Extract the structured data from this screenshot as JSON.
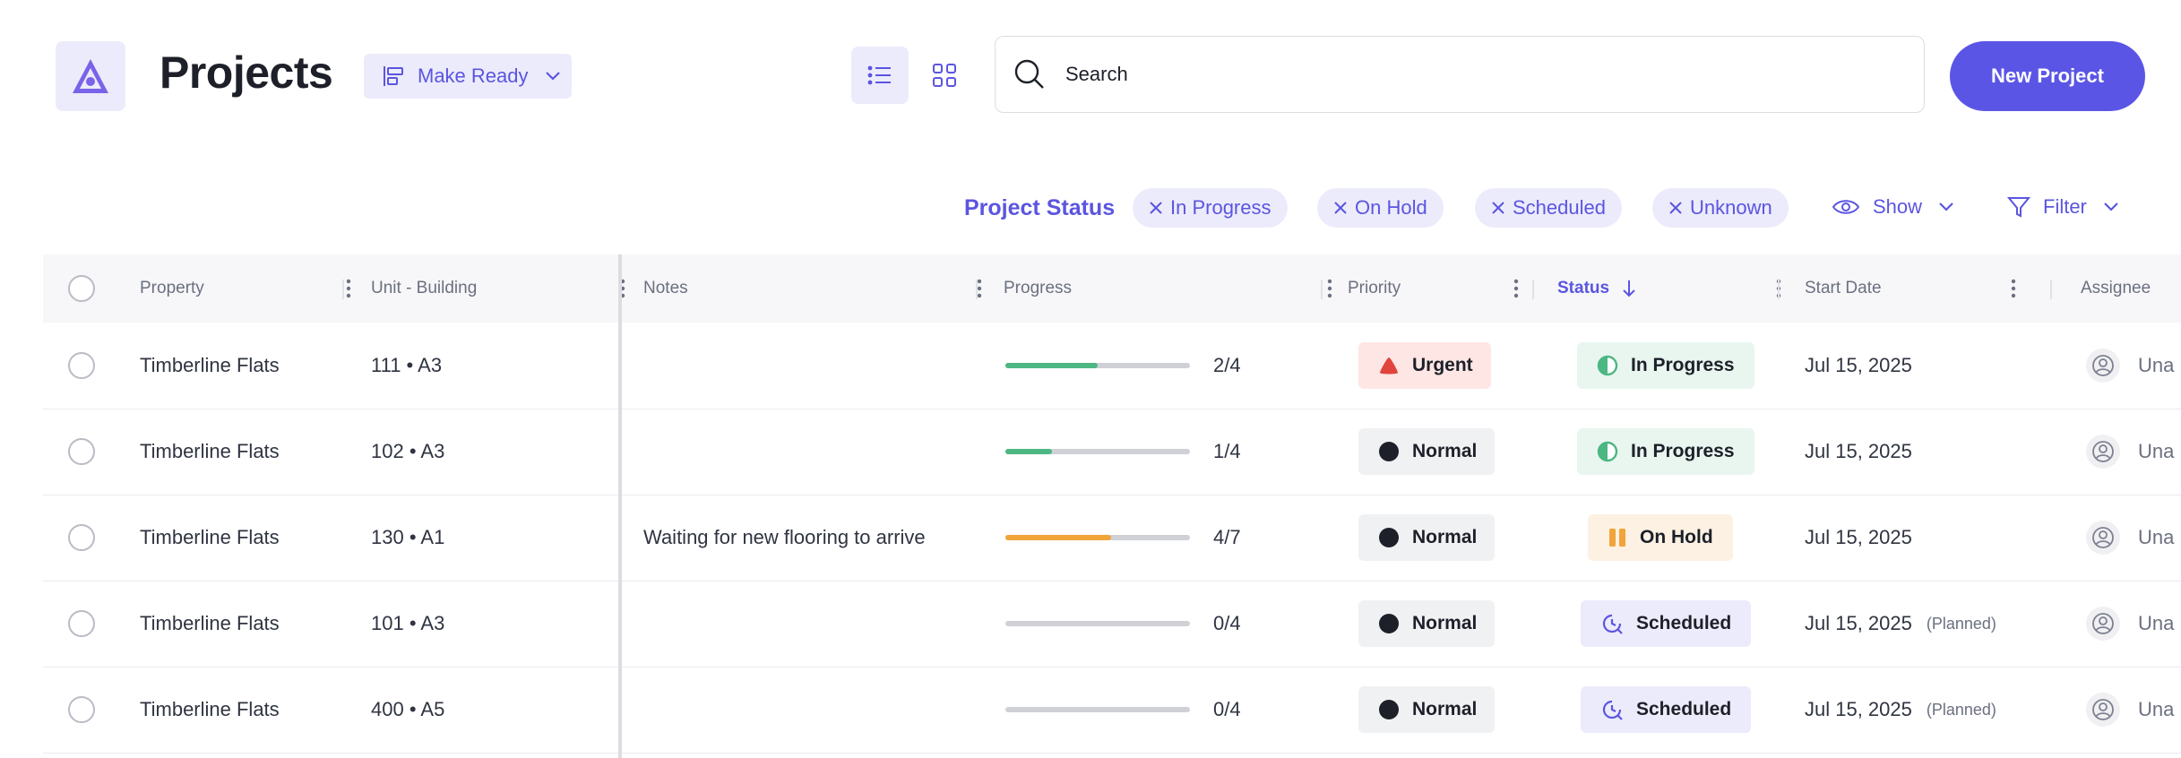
{
  "header": {
    "title": "Projects",
    "board": "Make Ready",
    "search_placeholder": "Search",
    "new_project": "New Project"
  },
  "filters": {
    "label": "Project Status",
    "chips": [
      "In Progress",
      "On Hold",
      "Scheduled",
      "Unknown"
    ],
    "show": "Show",
    "filter": "Filter"
  },
  "columns": {
    "property": "Property",
    "unit": "Unit - Building",
    "notes": "Notes",
    "progress": "Progress",
    "priority": "Priority",
    "status": "Status",
    "start_date": "Start Date",
    "assignee": "Assignee"
  },
  "colors": {
    "accent": "#5b55e6",
    "progress_green": "#4cb782",
    "progress_orange": "#f0a43a",
    "urgent_red": "#e0443c"
  },
  "rows": [
    {
      "property": "Timberline Flats",
      "unit": "111 • A3",
      "notes": "",
      "progress_done": 2,
      "progress_total": 4,
      "progress_text": "2/4",
      "priority": "Urgent",
      "status": "In Progress",
      "start": "Jul 15, 2025",
      "planned": "",
      "assignee": "Una"
    },
    {
      "property": "Timberline Flats",
      "unit": "102 • A3",
      "notes": "",
      "progress_done": 1,
      "progress_total": 4,
      "progress_text": "1/4",
      "priority": "Normal",
      "status": "In Progress",
      "start": "Jul 15, 2025",
      "planned": "",
      "assignee": "Una"
    },
    {
      "property": "Timberline Flats",
      "unit": "130 • A1",
      "notes": "Waiting for new flooring to arrive",
      "progress_done": 4,
      "progress_total": 7,
      "progress_text": "4/7",
      "priority": "Normal",
      "status": "On Hold",
      "start": "Jul 15, 2025",
      "planned": "",
      "assignee": "Una"
    },
    {
      "property": "Timberline Flats",
      "unit": "101 • A3",
      "notes": "",
      "progress_done": 0,
      "progress_total": 4,
      "progress_text": "0/4",
      "priority": "Normal",
      "status": "Scheduled",
      "start": "Jul 15, 2025",
      "planned": "(Planned)",
      "assignee": "Una"
    },
    {
      "property": "Timberline Flats",
      "unit": "400 • A5",
      "notes": "",
      "progress_done": 0,
      "progress_total": 4,
      "progress_text": "0/4",
      "priority": "Normal",
      "status": "Scheduled",
      "start": "Jul 15, 2025",
      "planned": "(Planned)",
      "assignee": "Una"
    }
  ]
}
